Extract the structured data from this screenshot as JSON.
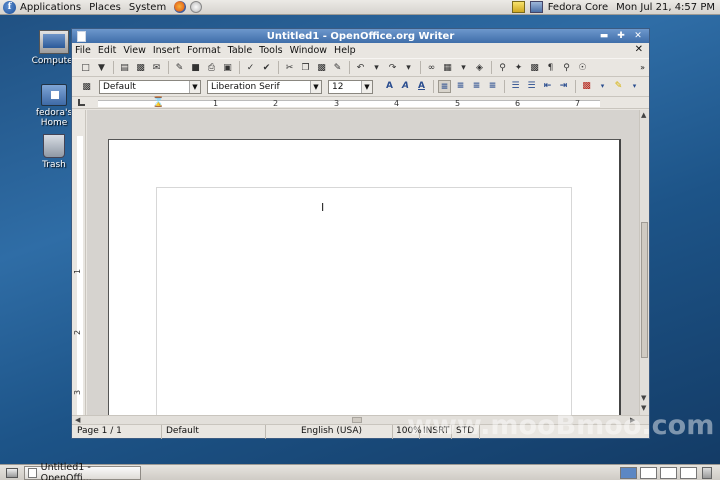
{
  "top_panel": {
    "menus": [
      "Applications",
      "Places",
      "System"
    ],
    "host": "Fedora Core",
    "clock": "Mon Jul 21,  4:57 PM"
  },
  "desktop_icons": [
    {
      "label": "Computer"
    },
    {
      "label": "fedora's Home"
    },
    {
      "label": "Trash"
    }
  ],
  "window": {
    "title": "Untitled1 - OpenOffice.org Writer",
    "menu": [
      "File",
      "Edit",
      "View",
      "Insert",
      "Format",
      "Table",
      "Tools",
      "Window",
      "Help"
    ],
    "paragraph_style": "Default",
    "font_name": "Liberation Serif",
    "font_size": "12",
    "ruler_numbers": [
      "1",
      "2",
      "3",
      "4",
      "5",
      "6",
      "7"
    ],
    "vruler_numbers": [
      "1",
      "2",
      "3"
    ],
    "status": {
      "page": "Page 1 / 1",
      "page_style": "Default",
      "language": "English (USA)",
      "zoom": "100%",
      "insert_mode": "INSRT",
      "selection_mode": "STD"
    }
  },
  "taskbar": {
    "task_label": "Untitled1 - OpenOffi..."
  },
  "watermark": "www.mooBmoo.com"
}
